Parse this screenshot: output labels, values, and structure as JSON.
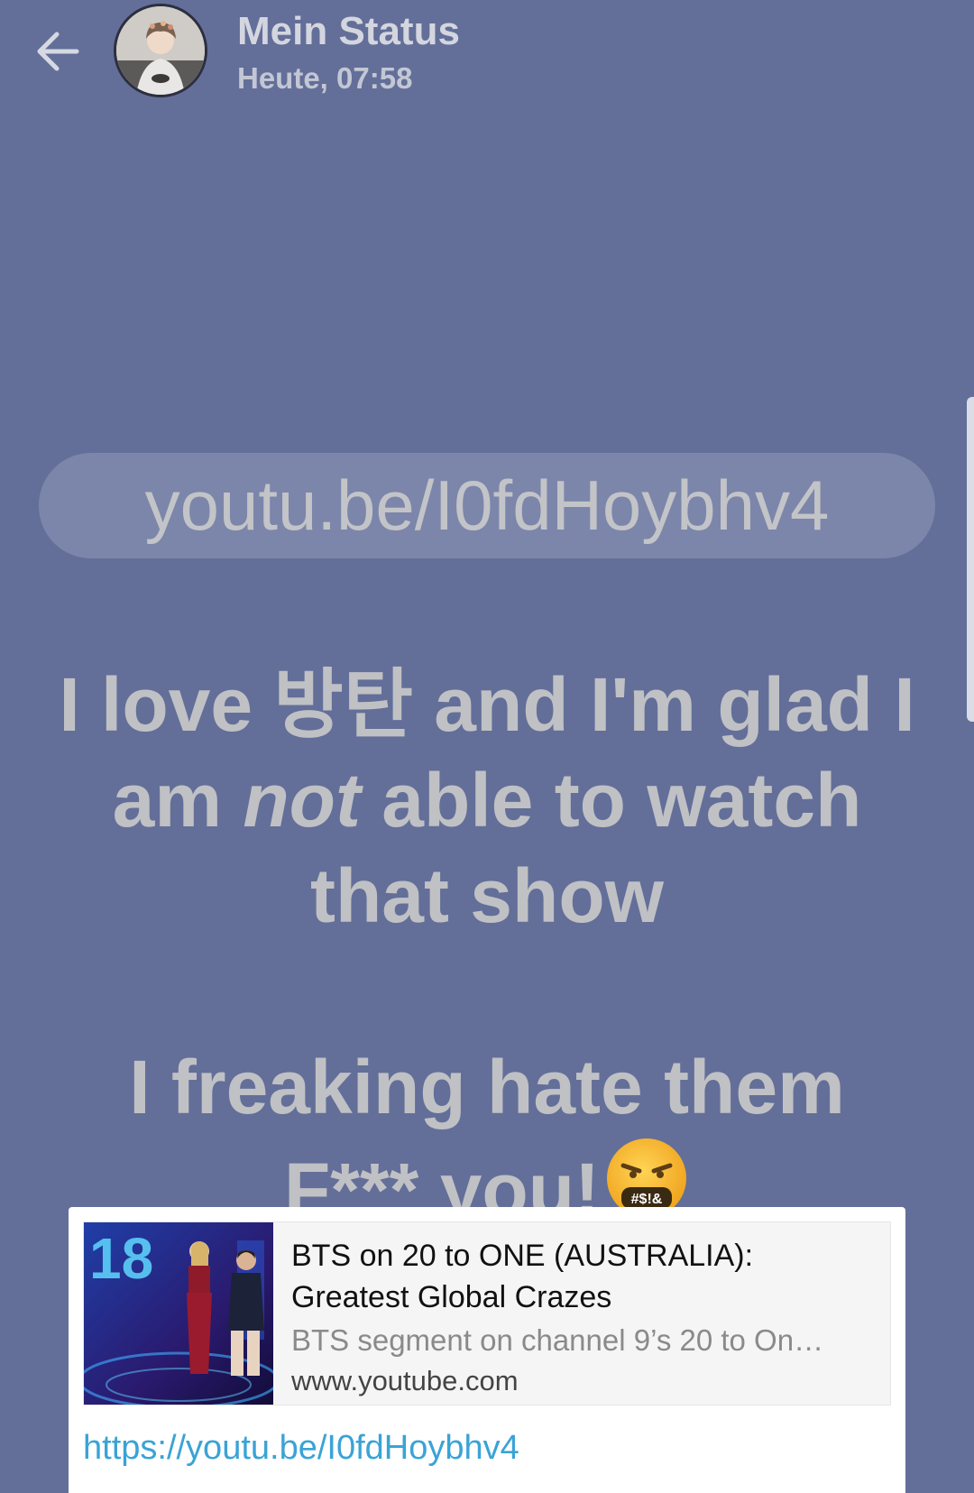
{
  "header": {
    "title": "Mein Status",
    "subtitle": "Heute, 07:58",
    "back_icon": "arrow-left-icon",
    "avatar": "avatar"
  },
  "status": {
    "url_pill": "youtu.be/I0fdHoybhv4",
    "line1": "I love 방탄 and I'm glad I",
    "line2_start": "am ",
    "line2_emph": "not",
    "line2_end": " able to watch",
    "line3": "that show",
    "line4": "I freaking hate them",
    "line5": "F*** you!",
    "emoji": "face-with-symbols-on-mouth-icon",
    "emoji_text": "#$!&"
  },
  "link_preview": {
    "title": "BTS on 20 to ONE (AUSTRALIA): Greatest Global Crazes",
    "description": "BTS segment on channel 9’s 20 to On…",
    "domain": "www.youtube.com",
    "url": "https://youtu.be/I0fdHoybhv4",
    "thumbnail_text": "18"
  },
  "colors": {
    "background": "#636f99",
    "link": "#3aa3d6"
  }
}
